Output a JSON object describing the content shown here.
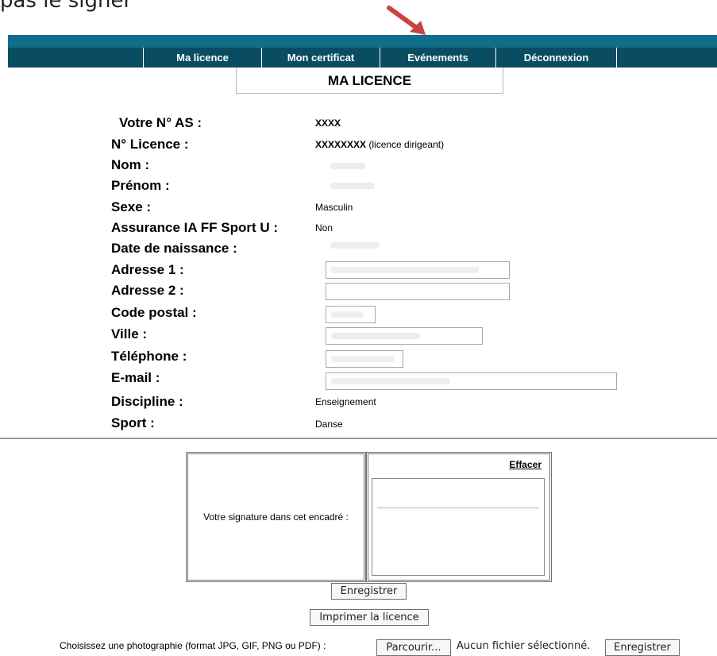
{
  "top_cut_text": "pas le signer",
  "nav": {
    "items": [
      "Ma licence",
      "Mon certificat",
      "Evénements",
      "Déconnexion"
    ]
  },
  "page_title": "MA LICENCE",
  "fields": {
    "as_label": "Votre N° AS :",
    "as_value": "XXXX",
    "licence_label": "N° Licence :",
    "licence_value": "XXXXXXXX",
    "licence_note": "(licence dirigeant)",
    "nom_label": "Nom :",
    "prenom_label": "Prénom :",
    "sexe_label": "Sexe :",
    "sexe_value": "Masculin",
    "assurance_label": "Assurance IA FF Sport U :",
    "assurance_value": "Non",
    "naissance_label": "Date de naissance :",
    "adresse1_label": "Adresse 1 :",
    "adresse2_label": "Adresse 2 :",
    "cp_label": "Code postal :",
    "ville_label": "Ville :",
    "tel_label": "Téléphone :",
    "email_label": "E-mail :",
    "discipline_label": "Discipline :",
    "discipline_value": "Enseignement",
    "sport_label": "Sport :",
    "sport_value": "Danse"
  },
  "signature": {
    "label": "Votre signature dans cet encadré :",
    "clear_link": "Effacer"
  },
  "buttons": {
    "save_signature": "Enregistrer",
    "print": "Imprimer la licence",
    "browse": "Parcourir...",
    "save_photo": "Enregistrer"
  },
  "photo": {
    "prompt": "Choisissez une photographie (format JPG, GIF, PNG ou PDF) :",
    "file_status": "Aucun fichier sélectionné."
  },
  "colors": {
    "nav_top": "#0f6e89",
    "nav_bar": "#0a4d63",
    "arrow": "#c94440"
  }
}
